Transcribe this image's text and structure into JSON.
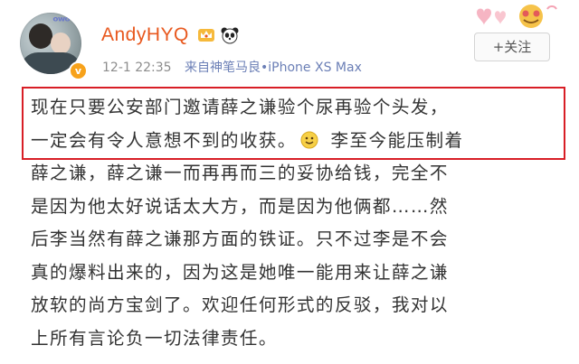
{
  "post": {
    "author": {
      "name": "AndyHYQ",
      "avatar_doodle": "ᵒʷᵒ",
      "verified": true
    },
    "meta": {
      "time": "12-1 22:35",
      "source": "来自神笔马良•iPhone XS Max"
    },
    "follow_label": "+关注",
    "icons": {
      "badge_1": "crown-icon",
      "badge_2": "panda-icon",
      "emoji": "smiley-icon",
      "verified": "verified-icon"
    },
    "lines": [
      "现在只要公安部门邀请薛之谦验个尿再验个头发，",
      "一定会有令人意想不到的收获。",
      " 李至今能压制着",
      "薛之谦，薛之谦一而再再而三的妥协给钱，完全不",
      "是因为他太好说话太大方，而是因为他俩都……然",
      "后李当然有薛之谦那方面的铁证。只不过李是不会",
      "真的爆料出来的，因为这是她唯一能用来让薛之谦",
      "放软的尚方宝剑了。欢迎任何形式的反驳，我对以",
      "上所有言论负一切法律责任。"
    ],
    "highlight_color": "#d81e26",
    "name_color": "#e8581e"
  }
}
